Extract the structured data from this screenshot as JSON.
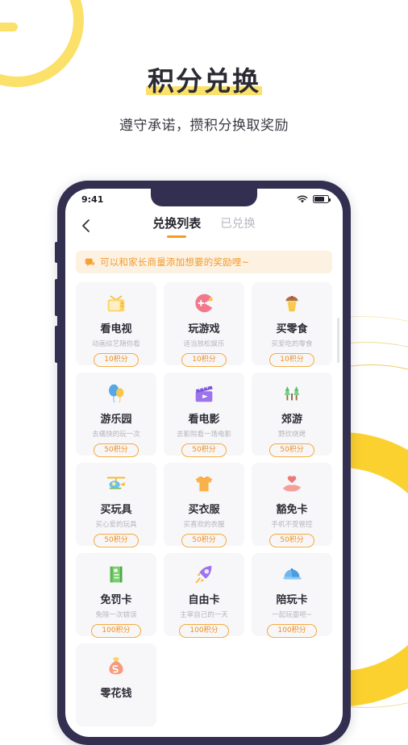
{
  "hero": {
    "title": "积分兑换",
    "subtitle": "遵守承诺，攒积分换取奖励"
  },
  "phone": {
    "statusbar": {
      "time": "9:41",
      "wifi_icon": "wifi-icon",
      "battery_icon": "battery-icon"
    },
    "navbar": {
      "back_icon": "back-chevron-icon",
      "tabs": [
        {
          "label": "兑换列表",
          "active": true
        },
        {
          "label": "已兑换",
          "active": false
        }
      ]
    },
    "notice": {
      "icon": "chat-bubble-icon",
      "text": "可以和家长商量添加想要的奖励哩~"
    },
    "cards": [
      {
        "icon": "tv-icon",
        "title": "看电视",
        "desc": "动画综艺随你看",
        "points": "10积分"
      },
      {
        "icon": "game-icon",
        "title": "玩游戏",
        "desc": "适当放松娱乐",
        "points": "10积分"
      },
      {
        "icon": "cupcake-icon",
        "title": "买零食",
        "desc": "买爱吃的零食",
        "points": "10积分"
      },
      {
        "icon": "balloon-icon",
        "title": "游乐园",
        "desc": "去痛快的玩一次",
        "points": "50积分"
      },
      {
        "icon": "clapperboard-icon",
        "title": "看电影",
        "desc": "去影院看一场电影",
        "points": "50积分"
      },
      {
        "icon": "trees-icon",
        "title": "郊游",
        "desc": "野炊烧烤",
        "points": "50积分"
      },
      {
        "icon": "helicopter-icon",
        "title": "买玩具",
        "desc": "买心爱的玩具",
        "points": "50积分"
      },
      {
        "icon": "tshirt-icon",
        "title": "买衣服",
        "desc": "买喜欢的衣服",
        "points": "50积分"
      },
      {
        "icon": "hand-heart-icon",
        "title": "豁免卡",
        "desc": "手机不受管控",
        "points": "50积分"
      },
      {
        "icon": "notebook-icon",
        "title": "免罚卡",
        "desc": "免除一次错误",
        "points": "100积分"
      },
      {
        "icon": "rocket-icon",
        "title": "自由卡",
        "desc": "主宰自己的一天",
        "points": "100积分"
      },
      {
        "icon": "cap-icon",
        "title": "陪玩卡",
        "desc": "一起玩耍吧~",
        "points": "100积分"
      },
      {
        "icon": "money-bag-icon",
        "title": "零花钱",
        "desc": "",
        "points": ""
      }
    ]
  },
  "colors": {
    "accent_yellow": "#fbd130",
    "highlight_yellow": "#fbe06a",
    "accent_orange": "#f08c1e",
    "phone_frame": "#332f50",
    "card_bg": "#f7f7f9",
    "notice_bg": "#fdf2e2"
  }
}
